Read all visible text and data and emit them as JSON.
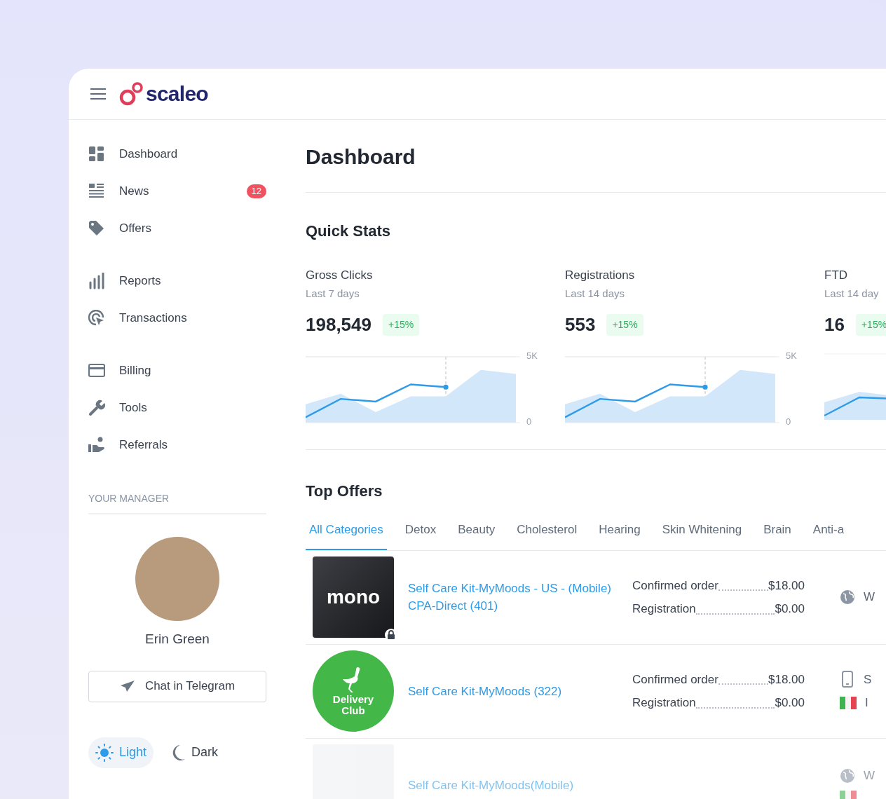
{
  "header": {
    "logo": "scaleo"
  },
  "sidebar": {
    "items": [
      {
        "label": "Dashboard"
      },
      {
        "label": "News",
        "badge": "12"
      },
      {
        "label": "Offers"
      },
      {
        "label": "Reports"
      },
      {
        "label": "Transactions"
      },
      {
        "label": "Billing"
      },
      {
        "label": "Tools"
      },
      {
        "label": "Referrals"
      }
    ],
    "manager_heading": "YOUR MANAGER",
    "manager_name": "Erin Green",
    "chat_button": "Chat in Telegram",
    "theme": [
      {
        "label": "Light",
        "selected": true
      },
      {
        "label": "Dark",
        "selected": false
      }
    ]
  },
  "page_title": "Dashboard",
  "quick_stats": {
    "title": "Quick Stats",
    "stats": [
      {
        "label": "Gross Clicks",
        "period": "Last 7 days",
        "value": "198,549",
        "change": "+15%",
        "chart_data": {
          "type": "area",
          "yticks": [
            0,
            {
              "value": 5000,
              "label": "5K"
            }
          ],
          "ylim": [
            0,
            5000
          ],
          "series": [
            {
              "type": "area",
              "color": "#d3e7fa",
              "values": [
                1400,
                2200,
                800,
                2000,
                2000,
                4000,
                3700
              ]
            },
            {
              "type": "line",
              "color": "#2d9be8",
              "values": [
                400,
                1800,
                1600,
                2900,
                2700,
                null,
                null
              ]
            }
          ]
        }
      },
      {
        "label": "Registrations",
        "period": "Last 14 days",
        "value": "553",
        "change": "+15%",
        "chart_data": {
          "type": "area",
          "yticks": [
            0,
            {
              "value": 5000,
              "label": "5K"
            }
          ],
          "ylim": [
            0,
            5000
          ],
          "series": [
            {
              "type": "area",
              "color": "#d3e7fa",
              "values": [
                1400,
                2200,
                800,
                2000,
                2000,
                4000,
                3700
              ]
            },
            {
              "type": "line",
              "color": "#2d9be8",
              "values": [
                400,
                1800,
                1600,
                2900,
                2700,
                null,
                null
              ]
            }
          ]
        }
      },
      {
        "label": "FTD",
        "period": "Last 14 day",
        "value": "16",
        "change": "+15%"
      }
    ]
  },
  "top_offers": {
    "title": "Top Offers",
    "tabs": [
      {
        "label": "All Categories",
        "selected": true
      },
      {
        "label": "Detox",
        "selected": false
      },
      {
        "label": "Beauty",
        "selected": false
      },
      {
        "label": "Cholesterol",
        "selected": false
      },
      {
        "label": "Hearing",
        "selected": false
      },
      {
        "label": "Skin Whitening",
        "selected": false
      },
      {
        "label": "Brain",
        "selected": false
      },
      {
        "label": "Anti-a",
        "selected": false
      }
    ],
    "offers": [
      {
        "logo": {
          "kind": "mono",
          "text": "mono"
        },
        "locked": true,
        "name": "Self Care Kit-MyMoods - US - (Mobile) CPA-Direct (401)",
        "payouts": [
          {
            "label": "Confirmed order",
            "amount": "$18.00"
          },
          {
            "label": "Registration",
            "amount": "$0.00"
          }
        ],
        "targets": [
          {
            "kind": "globe",
            "text": "W"
          }
        ]
      },
      {
        "logo": {
          "kind": "delivery",
          "text": "Delivery Club"
        },
        "locked": false,
        "name": "Self Care Kit-MyMoods (322)",
        "payouts": [
          {
            "label": "Confirmed order",
            "amount": "$18.00"
          },
          {
            "label": "Registration",
            "amount": "$0.00"
          }
        ],
        "targets": [
          {
            "kind": "phone",
            "text": "S"
          },
          {
            "kind": "flag",
            "text": "I"
          }
        ]
      },
      {
        "logo": {
          "kind": "placeholder"
        },
        "name": "Self Care Kit-MyMoods(Mobile)",
        "targets": [
          {
            "kind": "globe",
            "text": "W"
          },
          {
            "kind": "flag"
          }
        ]
      }
    ]
  }
}
